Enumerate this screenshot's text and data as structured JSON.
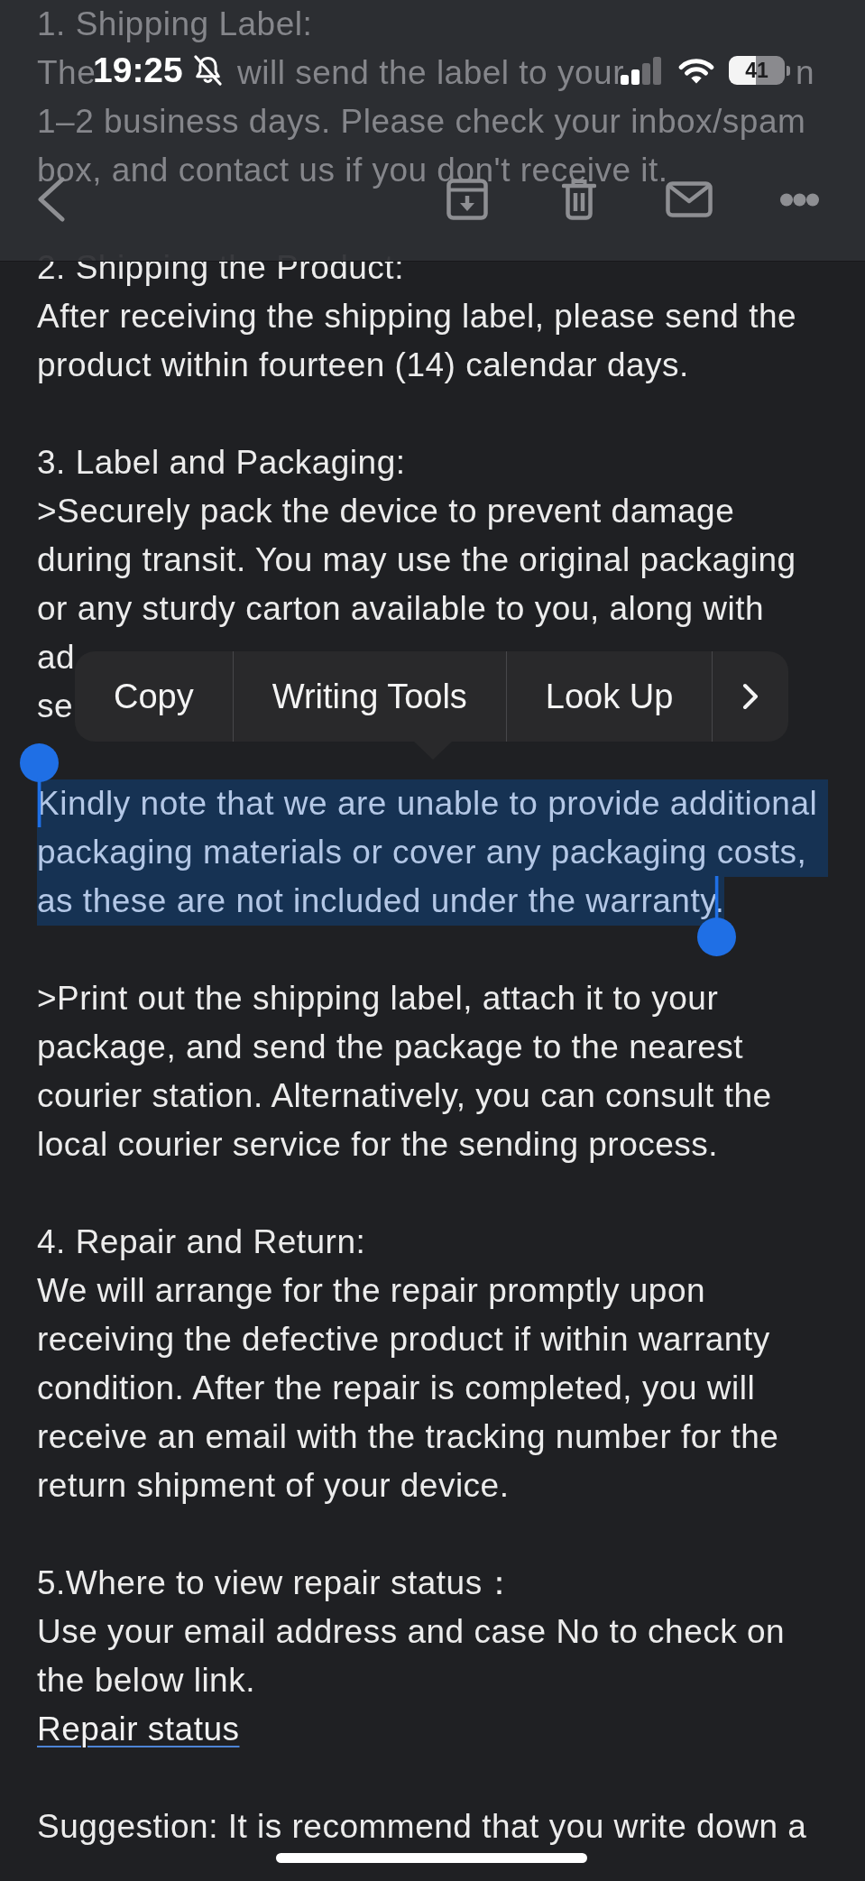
{
  "status_bar": {
    "time": "19:25",
    "silent_mode": true,
    "battery": "41"
  },
  "email": {
    "sections": [
      {
        "heading": "1. Shipping Label:",
        "blocks": [
          {
            "kind": "partial_lines",
            "lines": [
              [
                "The",
                "will send the label to your",
                "n"
              ],
              [
                "1–2 business days. Please check your inbox/spam"
              ],
              [
                "box, and contact us if you don't receive it."
              ]
            ]
          }
        ]
      },
      {
        "heading": "2. Shipping the Product:",
        "blocks": [
          {
            "kind": "paragraph",
            "selected": false,
            "lines": [
              "After receiving the shipping label, please send the",
              "product within fourteen (14) calendar days."
            ]
          }
        ]
      },
      {
        "heading": "3. Label and Packaging:",
        "blocks": [
          {
            "kind": "paragraph",
            "selected": false,
            "lines": [
              ">Securely pack the device to prevent damage",
              "during transit. You may use the original packaging",
              "or any sturdy carton available to you, along with"
            ]
          },
          {
            "kind": "partial_lines",
            "lines": [
              [
                "ad"
              ],
              [
                "se"
              ]
            ]
          },
          {
            "kind": "paragraph",
            "selected": true,
            "lines": [
              "Kindly note that we are unable to provide additional",
              "packaging materials or cover any packaging costs,",
              "as these are not included under the warranty."
            ]
          },
          {
            "kind": "paragraph",
            "selected": false,
            "lines": [
              ">Print out the shipping label, attach it to your",
              "package, and send the package to the nearest",
              "courier station. Alternatively, you can consult the",
              "local courier service for the sending process."
            ]
          }
        ]
      },
      {
        "heading": "4. Repair and Return:",
        "blocks": [
          {
            "kind": "paragraph",
            "selected": false,
            "lines": [
              "We will arrange for the repair promptly upon",
              "receiving the defective product if within warranty",
              "condition. After the repair is completed, you will",
              "receive an email with the tracking number for the",
              "return shipment of your device."
            ]
          }
        ]
      },
      {
        "heading": "5.Where to view repair status：",
        "blocks": [
          {
            "kind": "paragraph",
            "selected": false,
            "lines": [
              "Use your email address and case No to check on",
              "the below link."
            ]
          },
          {
            "kind": "link",
            "text": "Repair status"
          }
        ]
      },
      {
        "blocks": [
          {
            "kind": "paragraph",
            "selected": false,
            "lines": [
              "Suggestion: It is recommend that you write down a"
            ]
          }
        ]
      }
    ]
  },
  "context_menu": {
    "items": [
      {
        "kind": "action",
        "label": "Copy"
      },
      {
        "kind": "action",
        "label": "Writing Tools"
      },
      {
        "kind": "action",
        "label": "Look Up"
      },
      {
        "kind": "next"
      }
    ]
  }
}
